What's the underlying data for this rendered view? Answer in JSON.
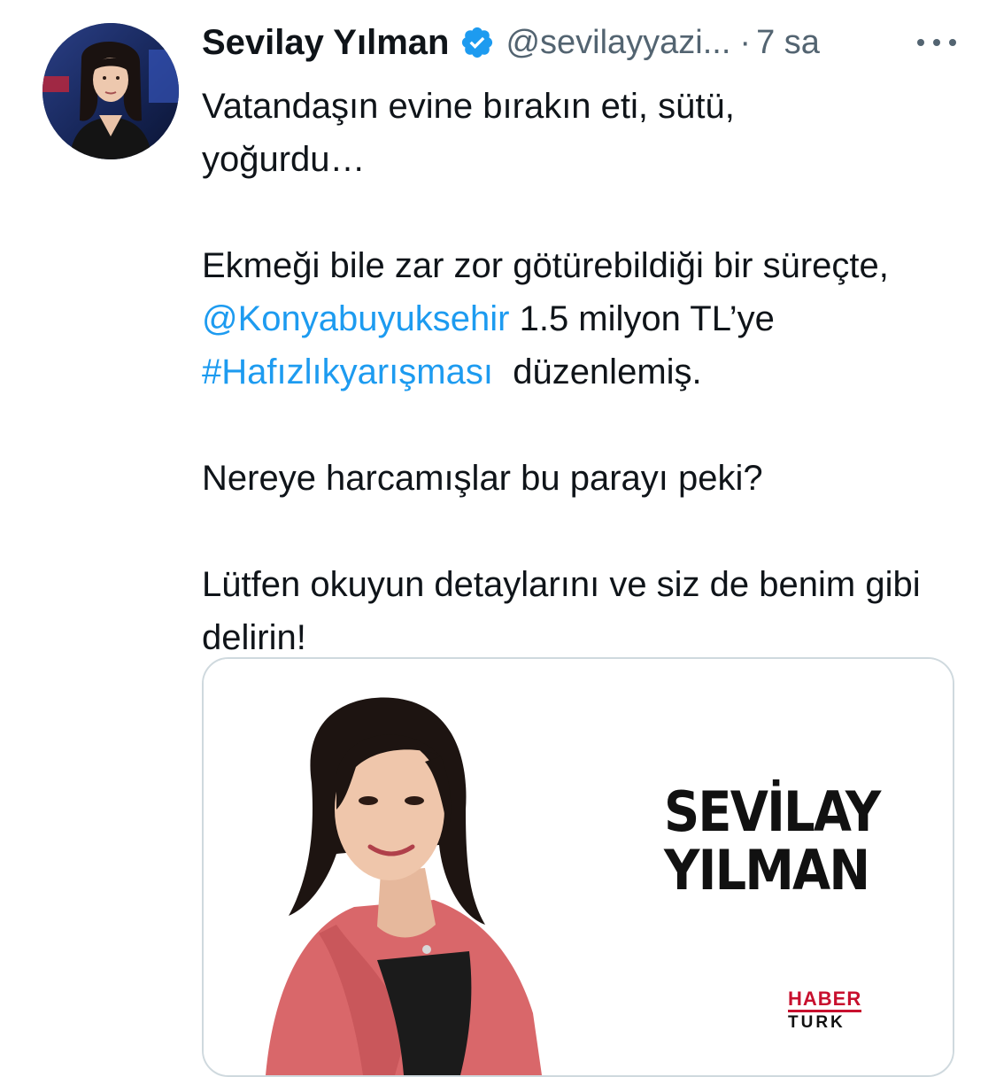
{
  "author": {
    "display_name": "Sevilay Yılman",
    "handle": "@sevilayyazi...",
    "separator": "·",
    "time": "7 sa",
    "verified_icon": "verified-badge-icon",
    "more_icon": "more-horizontal-icon"
  },
  "tweet": {
    "line1": "Vatandaşın evine bırakın eti, sütü,",
    "line2": "yoğurdu…",
    "para2_part1": "Ekmeği bile zar zor götürebildiği bir süreçte, ",
    "mention": "@Konyabuyuksehir",
    "para2_part2": " 1.5 milyon TL’ye ",
    "hashtag": "#Hafızlıkyarışması",
    "para2_part3": "  düzenlemiş.",
    "para3": "Nereye harcamışlar bu parayı peki?",
    "para4": "Lütfen okuyun detaylarını ve siz de benim gibi delirin!"
  },
  "card": {
    "title_line1": "SEVİLAY",
    "title_line2": "YILMAN",
    "brand_line1": "HABER",
    "brand_line2": "TURK"
  },
  "colors": {
    "link": "#1d9bf0",
    "verified": "#1d9bf0",
    "secondary_text": "#536471",
    "brand_red": "#c8102e",
    "jacket": "#d9676a"
  }
}
